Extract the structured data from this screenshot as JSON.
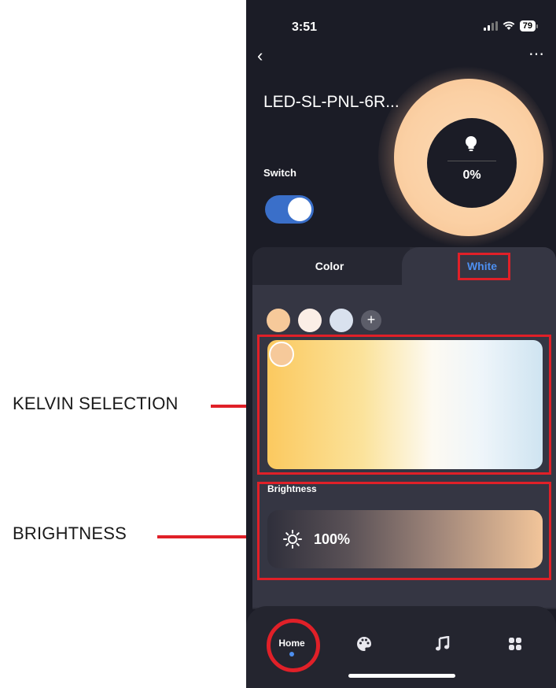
{
  "annotations": {
    "kelvin_label": "KELVIN SELECTION",
    "brightness_label": "BRIGHTNESS"
  },
  "status_bar": {
    "time": "3:51",
    "battery": "79"
  },
  "header": {
    "back_icon": "chevron-left-icon",
    "more_icon": "more-horizontal-icon"
  },
  "device": {
    "name": "LED-SL-PNL-6R...",
    "switch_label": "Switch",
    "switch_on": true,
    "power_percent": "0%"
  },
  "tabs": [
    {
      "label": "Color",
      "active": false
    },
    {
      "label": "White",
      "active": true
    }
  ],
  "presets": {
    "swatch_colors": [
      "#f6c99a",
      "#fbeee6",
      "#d9e1ee"
    ],
    "add_label": "+"
  },
  "kelvin": {
    "gradient_colors": [
      "#fbc95f",
      "#fdfaf2",
      "#cfe4f1"
    ]
  },
  "brightness": {
    "label": "Brightness",
    "value": "100%"
  },
  "nav": {
    "home_label": "Home",
    "items": [
      "home",
      "palette-icon",
      "music-icon",
      "apps-icon"
    ]
  },
  "colors": {
    "accent": "#4d8ff0",
    "annotation_red": "#e02028",
    "background": "#1b1c26"
  }
}
